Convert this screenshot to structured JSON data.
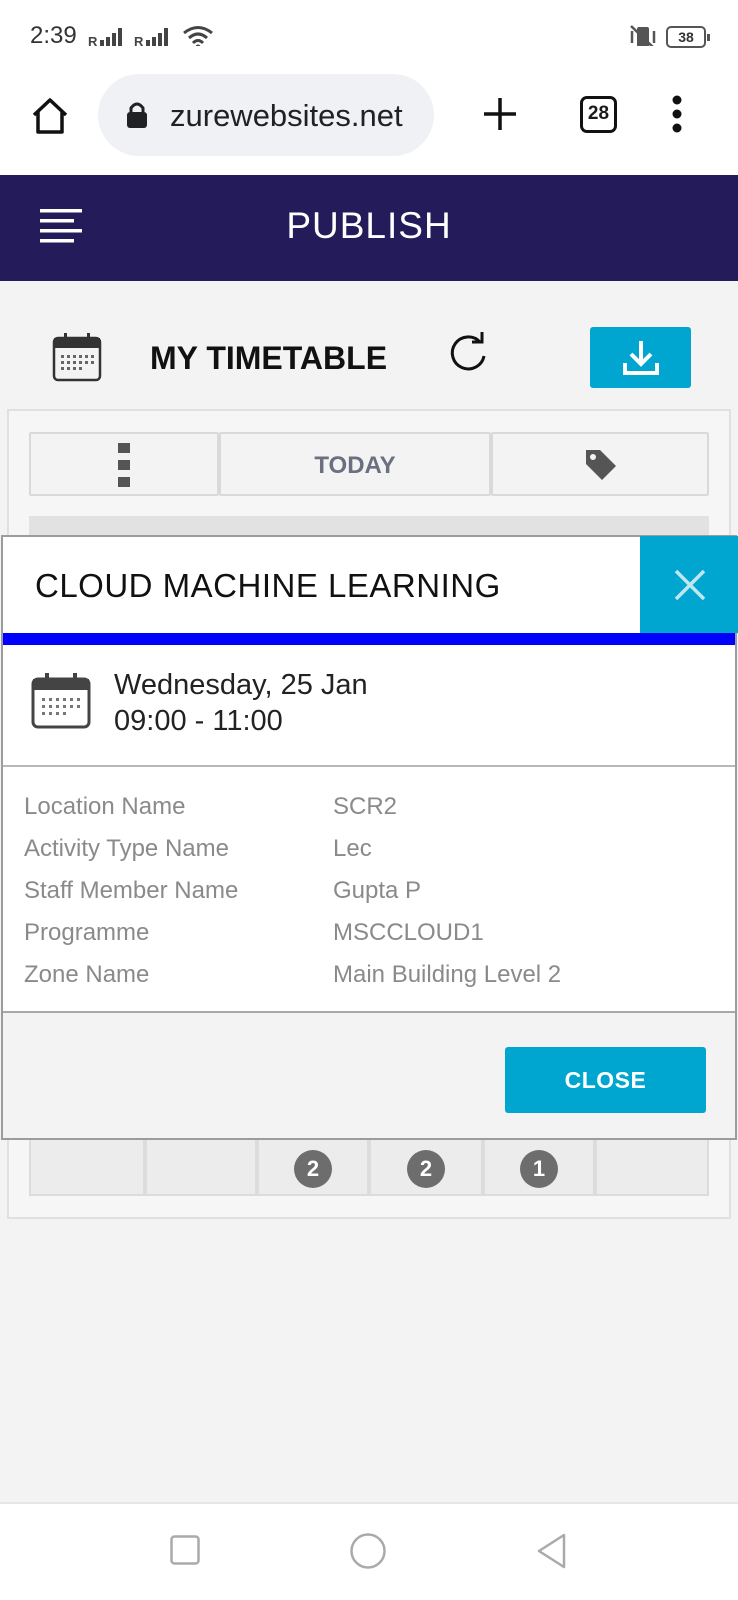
{
  "status_bar": {
    "time": "2:39",
    "battery": "38"
  },
  "browser": {
    "url": "zurewebsites.net",
    "tab_count": "28"
  },
  "app": {
    "title": "PUBLISH"
  },
  "timetable": {
    "title": "MY TIMETABLE",
    "today_label": "TODAY",
    "day_counts": [
      "2",
      "2",
      "1"
    ]
  },
  "modal": {
    "title": "CLOUD MACHINE LEARNING",
    "date": "Wednesday, 25 Jan",
    "time": "09:00 - 11:00",
    "details": [
      {
        "label": "Location Name",
        "value": "SCR2"
      },
      {
        "label": "Activity Type Name",
        "value": "Lec"
      },
      {
        "label": "Staff Member Name",
        "value": "Gupta P"
      },
      {
        "label": "Programme",
        "value": "MSCCLOUD1"
      },
      {
        "label": "Zone Name",
        "value": "Main Building Level 2"
      }
    ],
    "close_label": "CLOSE"
  },
  "colors": {
    "header": "#241b5a",
    "accent": "#00a6cf",
    "stripe": "#0000ff"
  }
}
